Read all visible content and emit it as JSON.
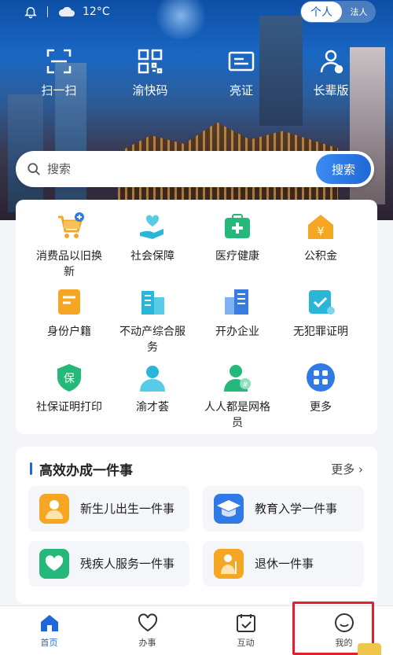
{
  "status_bar": {
    "temperature": "12°C"
  },
  "mode_toggle": {
    "active": "个人",
    "inactive": "法人"
  },
  "quick_actions": [
    {
      "label": "扫一扫",
      "icon": "scan-icon"
    },
    {
      "label": "渝快码",
      "icon": "qrcode-icon"
    },
    {
      "label": "亮证",
      "icon": "id-card-icon"
    },
    {
      "label": "长辈版",
      "icon": "elder-mode-icon"
    }
  ],
  "search": {
    "placeholder": "搜索",
    "button": "搜索"
  },
  "services": [
    {
      "label": "消费品以旧换新",
      "icon": "cart-icon",
      "color": "#f5a623"
    },
    {
      "label": "社会保障",
      "icon": "hand-heart-icon",
      "color": "#29b6d8"
    },
    {
      "label": "医疗健康",
      "icon": "medical-kit-icon",
      "color": "#25b87a"
    },
    {
      "label": "公积金",
      "icon": "house-fund-icon",
      "color": "#f5a623"
    },
    {
      "label": "身份户籍",
      "icon": "household-register-icon",
      "color": "#f5a623"
    },
    {
      "label": "不动产综合服务",
      "icon": "building-icon",
      "color": "#29b6d8"
    },
    {
      "label": "开办企业",
      "icon": "enterprise-icon",
      "color": "#3a7be0"
    },
    {
      "label": "无犯罪证明",
      "icon": "certificate-icon",
      "color": "#29b6d8"
    },
    {
      "label": "社保证明打印",
      "icon": "social-insurance-icon",
      "color": "#25b87a"
    },
    {
      "label": "渝才荟",
      "icon": "talent-icon",
      "color": "#29b6d8"
    },
    {
      "label": "人人都是网格员",
      "icon": "grid-member-icon",
      "color": "#25b87a"
    },
    {
      "label": "更多",
      "icon": "more-apps-icon",
      "color": "#2f7ae5"
    }
  ],
  "efficiency": {
    "title": "高效办成一件事",
    "more": "更多",
    "tasks": [
      {
        "label": "新生儿出生一件事",
        "icon": "newborn-icon",
        "color": "#f5a623"
      },
      {
        "label": "教育入学一件事",
        "icon": "graduation-cap-icon",
        "color": "#2f7ae5"
      },
      {
        "label": "残疾人服务一件事",
        "icon": "disability-care-icon",
        "color": "#25b87a"
      },
      {
        "label": "退休一件事",
        "icon": "retirement-icon",
        "color": "#f5a623"
      }
    ]
  },
  "bottom_nav": [
    {
      "label": "首页",
      "icon": "home-icon",
      "active": true
    },
    {
      "label": "办事",
      "icon": "heart-icon",
      "active": false
    },
    {
      "label": "互动",
      "icon": "calendar-check-icon",
      "active": false
    },
    {
      "label": "我的",
      "icon": "smile-icon",
      "active": false
    }
  ]
}
